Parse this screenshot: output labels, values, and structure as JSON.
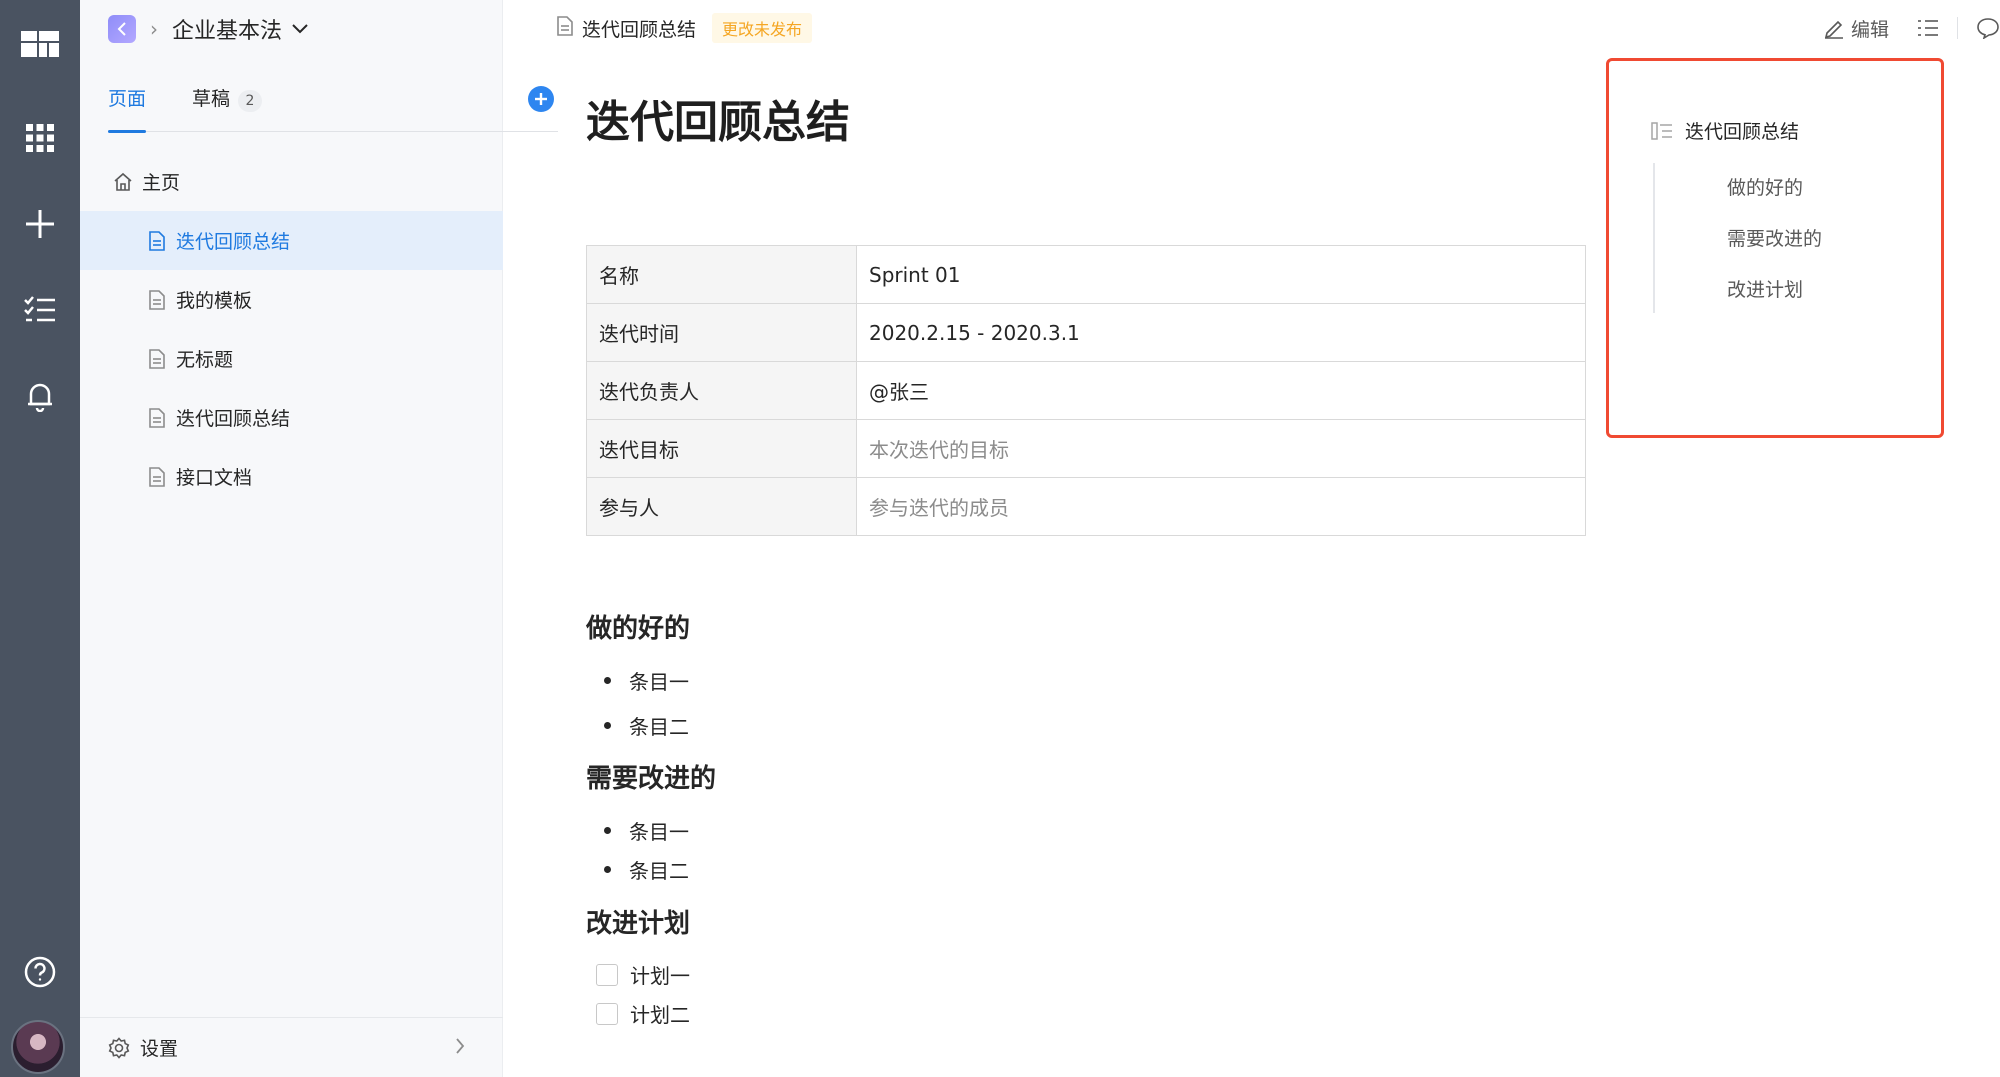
{
  "sidebar": {
    "space_name": "企业基本法",
    "tabs": [
      {
        "label": "页面"
      },
      {
        "label": "草稿",
        "count": "2"
      }
    ],
    "home_label": "主页",
    "pages": [
      {
        "label": "迭代回顾总结"
      },
      {
        "label": "我的模板"
      },
      {
        "label": "无标题"
      },
      {
        "label": "迭代回顾总结"
      },
      {
        "label": "接口文档"
      }
    ],
    "settings_label": "设置"
  },
  "topbar": {
    "doc_title": "迭代回顾总结",
    "status": "更改未发布",
    "edit_label": "编辑"
  },
  "document": {
    "title": "迭代回顾总结",
    "table": [
      {
        "key": "名称",
        "value": "Sprint 01"
      },
      {
        "key": "迭代时间",
        "value": "2020.2.15 - 2020.3.1"
      },
      {
        "key": "迭代负责人",
        "value": "@张三"
      },
      {
        "key": "迭代目标",
        "value": "本次迭代的目标"
      },
      {
        "key": "参与人",
        "value": "参与迭代的成员"
      }
    ],
    "sections": [
      {
        "heading": "做的好的",
        "items": [
          "条目一",
          "条目二"
        ]
      },
      {
        "heading": "需要改进的",
        "items": [
          "条目一",
          "条目二"
        ]
      },
      {
        "heading": "改进计划",
        "items": [
          "计划一",
          "计划二"
        ]
      }
    ]
  },
  "outline": {
    "title": "迭代回顾总结",
    "items": [
      "做的好的",
      "需要改进的",
      "改进计划"
    ]
  },
  "colors": {
    "rail": "#4a5361",
    "accent": "#1f7ae0",
    "status_bg": "#fff8e6",
    "status_text": "#f5a623",
    "highlight_border": "#f04a32"
  }
}
